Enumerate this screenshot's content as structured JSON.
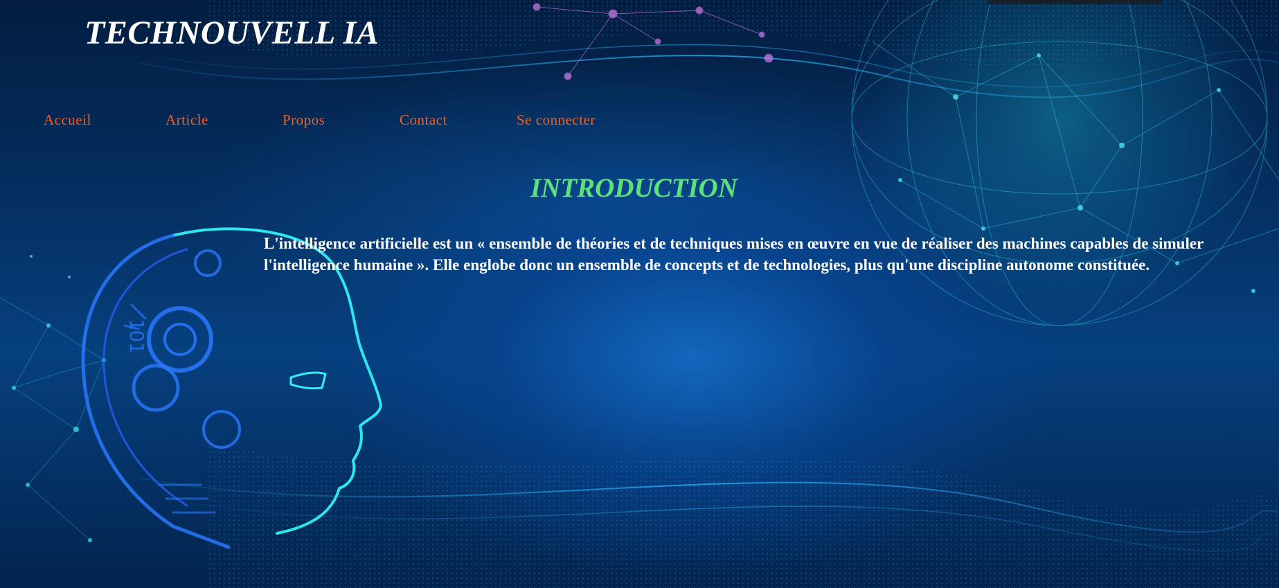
{
  "header": {
    "brand": "TECHNOUVELL IA"
  },
  "nav": {
    "items": [
      {
        "label": "Accueil"
      },
      {
        "label": "Article"
      },
      {
        "label": "Propos"
      },
      {
        "label": "Contact"
      },
      {
        "label": "Se connecter"
      }
    ]
  },
  "main": {
    "title": "INTRODUCTION",
    "paragraph": "L'intelligence artificielle est un « ensemble de théories et de techniques mises en œuvre en vue de réaliser des machines capables de simuler l'intelligence humaine ». Elle englobe donc un ensemble de concepts et de technologies, plus qu'une discipline autonome constituée."
  },
  "colors": {
    "nav_link": "#e8622a",
    "title": "#5ee07a",
    "text": "#ffffff",
    "background": "#053062"
  },
  "icons": {
    "background": "ai-head-and-network-globe-background"
  }
}
